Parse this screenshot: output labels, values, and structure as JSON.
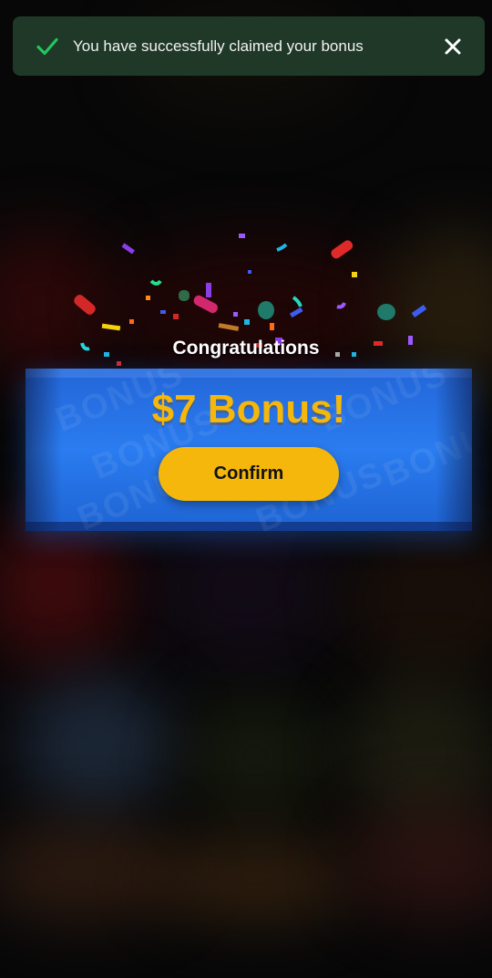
{
  "toast": {
    "message": "You have successfully claimed your bonus",
    "status_icon": "check-icon",
    "close_icon": "close-icon",
    "accent_color": "#22c55e"
  },
  "reward": {
    "congrats_label": "Congratulations",
    "bonus_text": "$7 Bonus!",
    "confirm_label": "Confirm",
    "watermark_word": "BONUS",
    "bonus_color": "#f5b70b",
    "banner_color": "#2a7cf0"
  }
}
